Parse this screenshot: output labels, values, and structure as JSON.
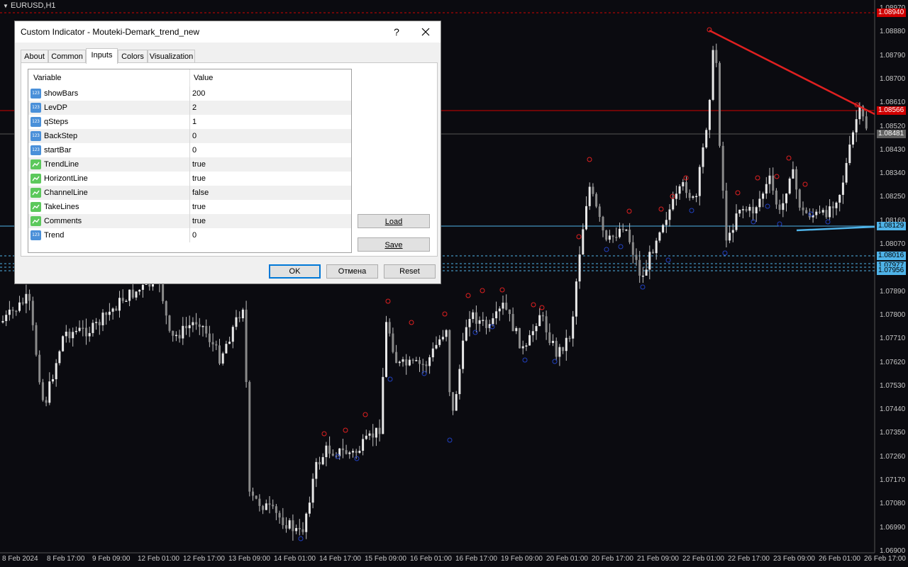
{
  "chart": {
    "symbol": "EURUSD,H1",
    "price_axis": [
      "1.08970",
      "1.08880",
      "1.08790",
      "1.08700",
      "1.08610",
      "1.08520",
      "1.08430",
      "1.08340",
      "1.08250",
      "1.08160",
      "1.08070",
      "1.07980",
      "1.07890",
      "1.07800",
      "1.07710",
      "1.07620",
      "1.07530",
      "1.07440",
      "1.07350",
      "1.07260",
      "1.07170",
      "1.07080",
      "1.06990",
      "1.06900"
    ],
    "price_tags": [
      {
        "value": "1.08940",
        "bg": "#d00000",
        "fg": "#ffffff"
      },
      {
        "value": "1.08566",
        "bg": "#d00000",
        "fg": "#ffffff"
      },
      {
        "value": "1.08481",
        "bg": "#606060",
        "fg": "#ffffff"
      },
      {
        "value": "1.08129",
        "bg": "#4fb3e8",
        "fg": "#000000"
      },
      {
        "value": "1.08016",
        "bg": "#4fb3e8",
        "fg": "#000000"
      },
      {
        "value": "1.07977",
        "bg": "#4fb3e8",
        "fg": "#000000"
      },
      {
        "value": "1.07956",
        "bg": "#4fb3e8",
        "fg": "#000000"
      }
    ],
    "time_axis": [
      "8 Feb 2024",
      "8 Feb 17:00",
      "9 Feb 09:00",
      "12 Feb 01:00",
      "12 Feb 17:00",
      "13 Feb 09:00",
      "14 Feb 01:00",
      "14 Feb 17:00",
      "15 Feb 09:00",
      "16 Feb 01:00",
      "16 Feb 17:00",
      "19 Feb 09:00",
      "20 Feb 01:00",
      "20 Feb 17:00",
      "21 Feb 09:00",
      "22 Feb 01:00",
      "22 Feb 17:00",
      "23 Feb 09:00",
      "26 Feb 01:00",
      "26 Feb 17:00"
    ],
    "colors": {
      "background": "#0b0b10",
      "candle": "#c0c0c0",
      "resistance": "#e02020",
      "support": "#4fb3e8",
      "high_marker": "#e02020",
      "low_marker": "#2040c0"
    }
  },
  "dialog": {
    "title": "Custom Indicator - Mouteki-Demark_trend_new",
    "help": "?",
    "tabs": [
      "About",
      "Common",
      "Inputs",
      "Colors",
      "Visualization"
    ],
    "active_tab": "Inputs",
    "grid_headers": {
      "variable": "Variable",
      "value": "Value"
    },
    "inputs": [
      {
        "name": "showBars",
        "value": "200",
        "type": "num"
      },
      {
        "name": "LevDP",
        "value": "2",
        "type": "num"
      },
      {
        "name": "qSteps",
        "value": "1",
        "type": "num"
      },
      {
        "name": "BackStep",
        "value": "0",
        "type": "num"
      },
      {
        "name": "startBar",
        "value": "0",
        "type": "num"
      },
      {
        "name": "TrendLine",
        "value": "true",
        "type": "bool"
      },
      {
        "name": "HorizontLine",
        "value": "true",
        "type": "bool"
      },
      {
        "name": "ChannelLine",
        "value": "false",
        "type": "bool"
      },
      {
        "name": "TakeLines",
        "value": "true",
        "type": "bool"
      },
      {
        "name": "Comments",
        "value": "true",
        "type": "bool"
      },
      {
        "name": "Trend",
        "value": "0",
        "type": "num"
      }
    ],
    "num_icon_text": "123",
    "load": "Load",
    "save": "Save",
    "ok": "OK",
    "cancel": "Отмена",
    "reset": "Reset"
  }
}
